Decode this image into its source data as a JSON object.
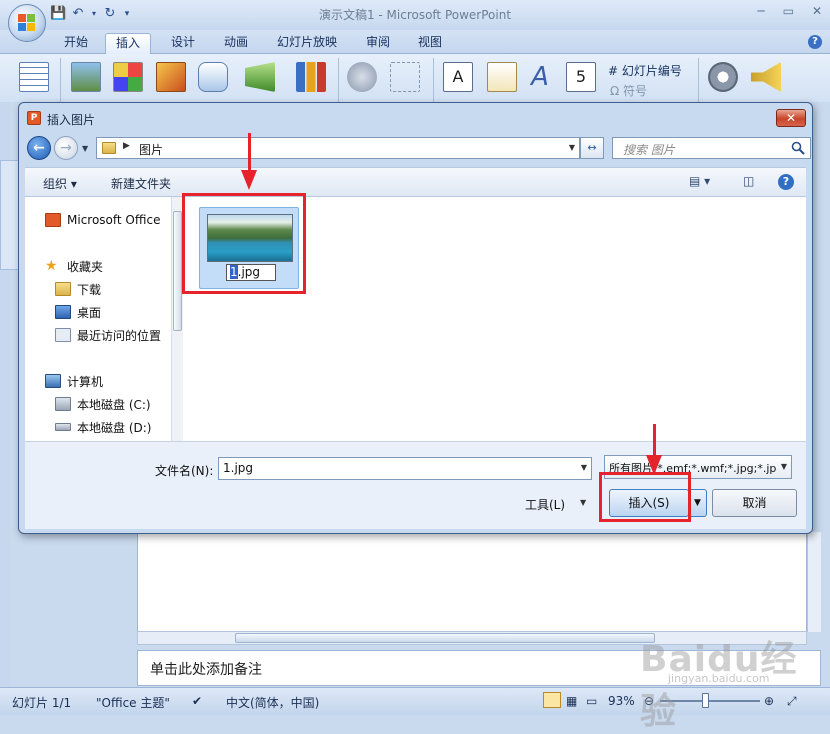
{
  "app": {
    "window_title": "演示文稿1 - Microsoft PowerPoint",
    "tabs": [
      "开始",
      "插入",
      "设计",
      "动画",
      "幻灯片放映",
      "审阅",
      "视图"
    ],
    "active_tab": "插入",
    "ribbon": {
      "slide_number": "幻灯片编号",
      "symbol": "符号"
    }
  },
  "dialog": {
    "title": "插入图片",
    "close": "✕",
    "address": {
      "path": "图片"
    },
    "search": {
      "placeholder": "搜索 图片"
    },
    "toolbar": {
      "organize": "组织 ▾",
      "new_folder": "新建文件夹"
    },
    "nav": {
      "top_item": "Microsoft Office",
      "favorites": "收藏夹",
      "downloads": "下载",
      "desktop": "桌面",
      "recent": "最近访问的位置",
      "computer": "计算机",
      "drive_c": "本地磁盘 (C:)",
      "drive_d": "本地磁盘 (D:)"
    },
    "file": {
      "name_sel": "1",
      "name_rest": ".jpg"
    },
    "filename_label": "文件名(N):",
    "filename_value": "1.jpg",
    "file_type": "所有图片(*.emf;*.wmf;*.jpg;*.jp",
    "tools": "工具(L)",
    "insert": "插入(S)",
    "cancel": "取消"
  },
  "notes_placeholder": "单击此处添加备注",
  "status": {
    "slide": "幻灯片 1/1",
    "theme": "\"Office 主题\"",
    "language": "中文(简体，中国)",
    "zoom": "93%"
  },
  "watermark": {
    "brand": "Baidu经验",
    "url": "jingyan.baidu.com"
  },
  "colors": {
    "annotation": "#e6232c",
    "accent": "#3064c8"
  }
}
